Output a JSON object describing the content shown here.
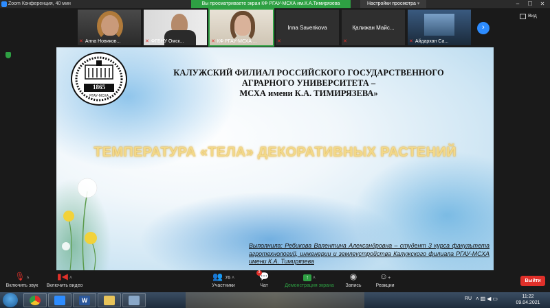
{
  "window": {
    "title": "Zoom Конференция, 40 мин",
    "share_banner": "Вы просматриваете экран КФ РГАУ-МСХА им.К.А.Тимирязева",
    "view_options": "Настройки просмотра"
  },
  "participants": [
    {
      "name": "Анна Новиков...",
      "muted": true
    },
    {
      "name": "ФГБНУ Омск...",
      "muted": true
    },
    {
      "name": "КФ РГАУ-МСХА ...",
      "muted": true
    },
    {
      "name": "Inna Savenkova",
      "muted": true
    },
    {
      "name": "Қалижан  Майс...",
      "muted": true
    },
    {
      "name": "Айдархан Са...",
      "muted": true
    }
  ],
  "view_label": "Вид",
  "slide": {
    "logo_year": "1865",
    "logo_caption": "РГАУ-МСХА",
    "org_line1": "КАЛУЖСКИЙ ФИЛИАЛ РОССИЙСКОГО ГОСУДАРСТВЕННОГО",
    "org_line2": "АГРАРНОГО УНИВЕРСИТЕТА –",
    "org_line3": "МСХА имени К.А. ТИМИРЯЗЕВА»",
    "title": "ТЕМПЕРАТУРА «ТЕЛА» ДЕКОРАТИВНЫХ РАСТЕНИЙ",
    "author": "Выполнила: Ребикова Валентина Александровна – студент 3 курса факультета агротехнологий, инженерии и землеустройства Калужского филиала РГАУ-МСХА имени К.А. Тимирязева"
  },
  "toolbar": {
    "audio": "Включить звук",
    "video": "Включить видео",
    "participants_label": "Участники",
    "participants_count": "76",
    "chat": "Чат",
    "chat_badge": "3",
    "share": "Демонстрация экрана",
    "record": "Запись",
    "reactions": "Реакции",
    "leave": "Выйти"
  },
  "taskbar": {
    "lang": "RU",
    "time": "11:22",
    "date": "09.04.2021"
  },
  "colors": {
    "accent_green": "#2ea043",
    "zoom_blue": "#2d8cff",
    "leave_red": "#e0302a"
  }
}
